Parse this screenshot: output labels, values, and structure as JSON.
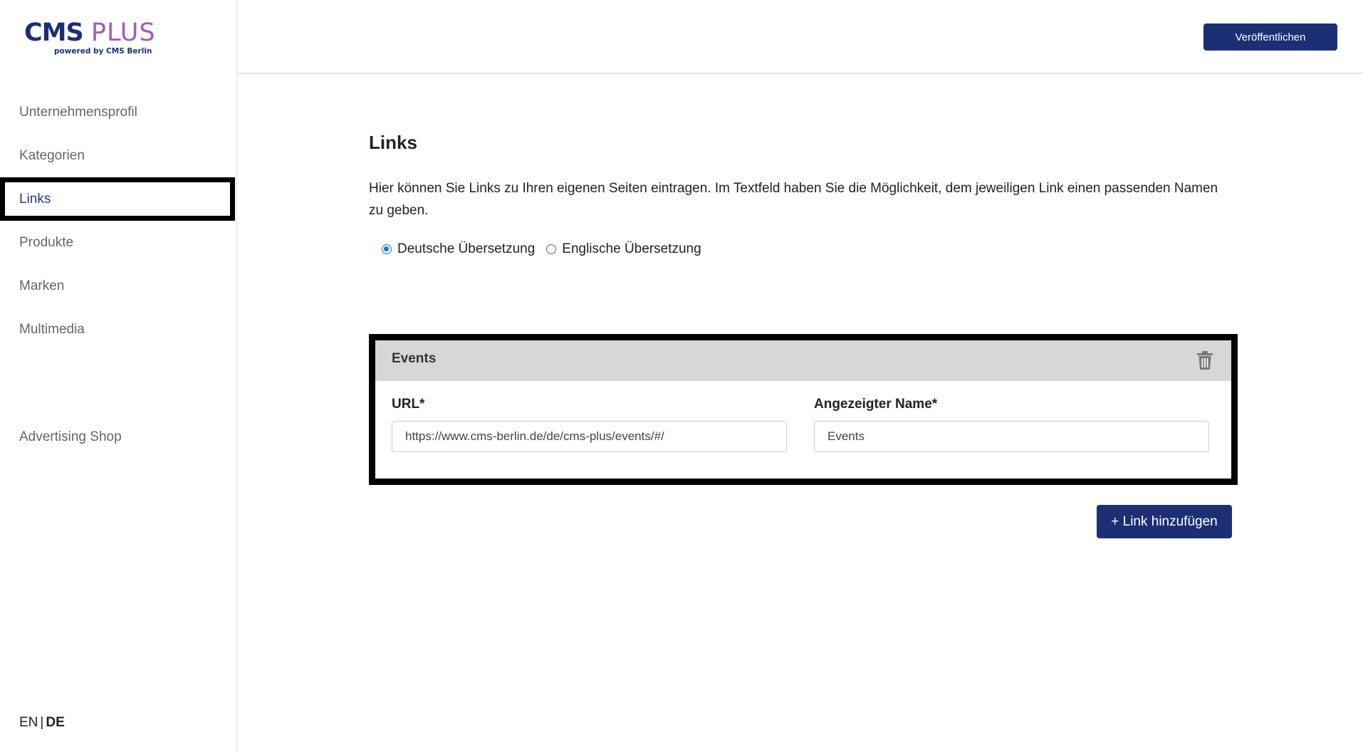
{
  "logo": {
    "cms": "CMS",
    "plus": "PLUS",
    "sub": "powered by CMS Berlin"
  },
  "sidebar": {
    "items": [
      {
        "label": "Unternehmensprofil"
      },
      {
        "label": "Kategorien"
      },
      {
        "label": "Links"
      },
      {
        "label": "Produkte"
      },
      {
        "label": "Marken"
      },
      {
        "label": "Multimedia"
      }
    ],
    "active": "Links",
    "shop_label": "Advertising Shop",
    "lang_en": "EN",
    "lang_sep": "|",
    "lang_de": "DE"
  },
  "topbar": {
    "publish_label": "Veröffentlichen"
  },
  "main": {
    "title": "Links",
    "intro": "Hier können Sie Links zu Ihren eigenen Seiten eintragen. Im Textfeld haben Sie die Möglichkeit, dem jeweiligen Link einen passenden Namen zu geben.",
    "radios": [
      {
        "label": "Deutsche Übersetzung",
        "checked": true
      },
      {
        "label": "Englische Übersetzung",
        "checked": false
      }
    ],
    "card": {
      "title": "Events",
      "url_label": "URL*",
      "url_value": "https://www.cms-berlin.de/de/cms-plus/events/#/",
      "name_label": "Angezeigter Name*",
      "name_value": "Events",
      "trash_icon": "trash-icon"
    },
    "add_label": "+ Link hinzufügen"
  },
  "colors": {
    "brand": "#1c2f74",
    "accent_plus": "#a15cb8",
    "radio": "#1a73e8"
  }
}
